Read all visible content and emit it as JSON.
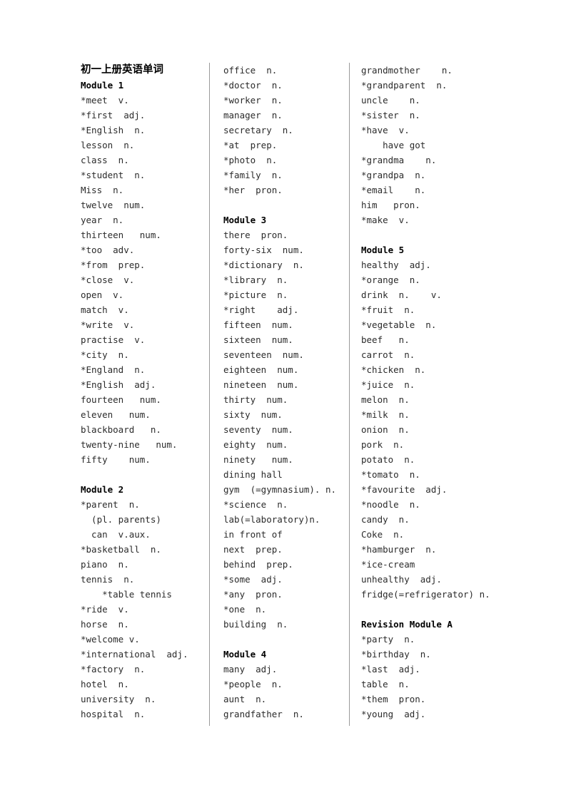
{
  "document": {
    "title": "初一上册英语单词"
  },
  "columns": [
    {
      "name": "column-1",
      "blocks": [
        {
          "type": "title",
          "text": "初一上册英语单词"
        },
        {
          "type": "heading",
          "text": "Module 1"
        },
        {
          "type": "entry",
          "text": "*meet  v."
        },
        {
          "type": "entry",
          "text": "*first  adj."
        },
        {
          "type": "entry",
          "text": "*English  n."
        },
        {
          "type": "entry",
          "text": "lesson  n."
        },
        {
          "type": "entry",
          "text": "class  n."
        },
        {
          "type": "entry",
          "text": "*student  n."
        },
        {
          "type": "entry",
          "text": "Miss  n."
        },
        {
          "type": "entry",
          "text": "twelve  num."
        },
        {
          "type": "entry",
          "text": "year  n."
        },
        {
          "type": "entry",
          "text": "thirteen   num."
        },
        {
          "type": "entry",
          "text": "*too  adv."
        },
        {
          "type": "entry",
          "text": "*from  prep."
        },
        {
          "type": "entry",
          "text": "*close  v."
        },
        {
          "type": "entry",
          "text": "open  v."
        },
        {
          "type": "entry",
          "text": "match  v."
        },
        {
          "type": "entry",
          "text": "*write  v."
        },
        {
          "type": "entry",
          "text": "practise  v."
        },
        {
          "type": "entry",
          "text": "*city  n."
        },
        {
          "type": "entry",
          "text": "*England  n."
        },
        {
          "type": "entry",
          "text": "*English  adj."
        },
        {
          "type": "entry",
          "text": "fourteen   num."
        },
        {
          "type": "entry",
          "text": "eleven   num."
        },
        {
          "type": "entry",
          "text": "blackboard   n."
        },
        {
          "type": "entry",
          "text": "twenty-nine   num."
        },
        {
          "type": "entry",
          "text": "fifty    num."
        },
        {
          "type": "spacer",
          "text": " "
        },
        {
          "type": "heading",
          "text": "Module 2"
        },
        {
          "type": "entry",
          "text": "*parent  n."
        },
        {
          "type": "entry",
          "text": "  (pl. parents)"
        },
        {
          "type": "entry",
          "text": "  can  v.aux."
        },
        {
          "type": "entry",
          "text": "*basketball  n."
        },
        {
          "type": "entry",
          "text": "piano  n."
        },
        {
          "type": "entry",
          "text": "tennis  n."
        },
        {
          "type": "entry",
          "text": "    *table tennis"
        },
        {
          "type": "entry",
          "text": "*ride  v."
        },
        {
          "type": "entry",
          "text": "horse  n."
        },
        {
          "type": "entry",
          "text": "*welcome v."
        },
        {
          "type": "entry",
          "text": "*international  adj."
        },
        {
          "type": "entry",
          "text": "*factory  n."
        },
        {
          "type": "entry",
          "text": "hotel  n."
        },
        {
          "type": "entry",
          "text": "university  n."
        },
        {
          "type": "entry",
          "text": "hospital  n."
        }
      ]
    },
    {
      "name": "column-2",
      "blocks": [
        {
          "type": "entry",
          "text": "office  n."
        },
        {
          "type": "entry",
          "text": "*doctor  n."
        },
        {
          "type": "entry",
          "text": "*worker  n."
        },
        {
          "type": "entry",
          "text": "manager  n."
        },
        {
          "type": "entry",
          "text": "secretary  n."
        },
        {
          "type": "entry",
          "text": "*at  prep."
        },
        {
          "type": "entry",
          "text": "*photo  n."
        },
        {
          "type": "entry",
          "text": "*family  n."
        },
        {
          "type": "entry",
          "text": "*her  pron."
        },
        {
          "type": "spacer",
          "text": " "
        },
        {
          "type": "heading",
          "text": "Module 3"
        },
        {
          "type": "entry",
          "text": "there  pron."
        },
        {
          "type": "entry",
          "text": "forty-six  num."
        },
        {
          "type": "entry",
          "text": "*dictionary  n."
        },
        {
          "type": "entry",
          "text": "*library  n."
        },
        {
          "type": "entry",
          "text": "*picture  n."
        },
        {
          "type": "entry",
          "text": "*right    adj."
        },
        {
          "type": "entry",
          "text": "fifteen  num."
        },
        {
          "type": "entry",
          "text": "sixteen  num."
        },
        {
          "type": "entry",
          "text": "seventeen  num."
        },
        {
          "type": "entry",
          "text": "eighteen  num."
        },
        {
          "type": "entry",
          "text": "nineteen  num."
        },
        {
          "type": "entry",
          "text": "thirty  num."
        },
        {
          "type": "entry",
          "text": "sixty  num."
        },
        {
          "type": "entry",
          "text": "seventy  num."
        },
        {
          "type": "entry",
          "text": "eighty  num."
        },
        {
          "type": "entry",
          "text": "ninety   num."
        },
        {
          "type": "entry",
          "text": "dining hall"
        },
        {
          "type": "entry",
          "text": "gym  (=gymnasium). n."
        },
        {
          "type": "entry",
          "text": "*science  n."
        },
        {
          "type": "entry",
          "text": "lab(=laboratory)n."
        },
        {
          "type": "entry",
          "text": "in front of"
        },
        {
          "type": "entry",
          "text": "next  prep."
        },
        {
          "type": "entry",
          "text": "behind  prep."
        },
        {
          "type": "entry",
          "text": "*some  adj."
        },
        {
          "type": "entry",
          "text": "*any  pron."
        },
        {
          "type": "entry",
          "text": "*one  n."
        },
        {
          "type": "entry",
          "text": "building  n."
        },
        {
          "type": "spacer",
          "text": " "
        },
        {
          "type": "heading",
          "text": "Module 4"
        },
        {
          "type": "entry",
          "text": "many  adj."
        },
        {
          "type": "entry",
          "text": "*people  n."
        },
        {
          "type": "entry",
          "text": "aunt  n."
        },
        {
          "type": "entry",
          "text": "grandfather  n."
        }
      ]
    },
    {
      "name": "column-3",
      "blocks": [
        {
          "type": "entry",
          "text": "grandmother    n."
        },
        {
          "type": "entry",
          "text": "*grandparent  n."
        },
        {
          "type": "entry",
          "text": "uncle    n."
        },
        {
          "type": "entry",
          "text": "*sister  n."
        },
        {
          "type": "entry",
          "text": "*have  v."
        },
        {
          "type": "entry",
          "text": "    have got"
        },
        {
          "type": "entry",
          "text": "*grandma    n."
        },
        {
          "type": "entry",
          "text": "*grandpa  n."
        },
        {
          "type": "entry",
          "text": "*email    n."
        },
        {
          "type": "entry",
          "text": "him   pron."
        },
        {
          "type": "entry",
          "text": "*make  v."
        },
        {
          "type": "spacer",
          "text": " "
        },
        {
          "type": "heading",
          "text": "Module 5"
        },
        {
          "type": "entry",
          "text": "healthy  adj."
        },
        {
          "type": "entry",
          "text": "*orange  n."
        },
        {
          "type": "entry",
          "text": "drink  n.    v."
        },
        {
          "type": "entry",
          "text": "*fruit  n."
        },
        {
          "type": "entry",
          "text": "*vegetable  n."
        },
        {
          "type": "entry",
          "text": "beef   n."
        },
        {
          "type": "entry",
          "text": "carrot  n."
        },
        {
          "type": "entry",
          "text": "*chicken  n."
        },
        {
          "type": "entry",
          "text": "*juice  n."
        },
        {
          "type": "entry",
          "text": "melon  n."
        },
        {
          "type": "entry",
          "text": "*milk  n."
        },
        {
          "type": "entry",
          "text": "onion  n."
        },
        {
          "type": "entry",
          "text": "pork  n."
        },
        {
          "type": "entry",
          "text": "potato  n."
        },
        {
          "type": "entry",
          "text": "*tomato  n."
        },
        {
          "type": "entry",
          "text": "*favourite  adj."
        },
        {
          "type": "entry",
          "text": "*noodle  n."
        },
        {
          "type": "entry",
          "text": "candy  n."
        },
        {
          "type": "entry",
          "text": "Coke  n."
        },
        {
          "type": "entry",
          "text": "*hamburger  n."
        },
        {
          "type": "entry",
          "text": "*ice-cream"
        },
        {
          "type": "entry",
          "text": "unhealthy  adj."
        },
        {
          "type": "entry",
          "text": "fridge(=refrigerator) n."
        },
        {
          "type": "spacer",
          "text": " "
        },
        {
          "type": "heading",
          "text": "Revision Module A"
        },
        {
          "type": "entry",
          "text": "*party  n."
        },
        {
          "type": "entry",
          "text": "*birthday  n."
        },
        {
          "type": "entry",
          "text": "*last  adj."
        },
        {
          "type": "entry",
          "text": "table  n."
        },
        {
          "type": "entry",
          "text": "*them  pron."
        },
        {
          "type": "entry",
          "text": "*young  adj."
        }
      ]
    }
  ]
}
